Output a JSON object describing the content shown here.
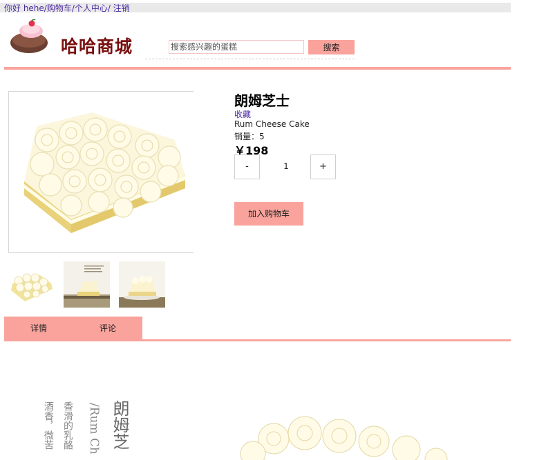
{
  "topbar": {
    "greeting": "你好 hehe",
    "cart": "购物车",
    "profile": "个人中心",
    "logout": " 注销",
    "sep": "/"
  },
  "brand": {
    "logo_text": "哈哈商城"
  },
  "search": {
    "placeholder": "搜索感兴趣的蛋糕",
    "button_label": "搜索"
  },
  "product": {
    "name": "朗姆芝士",
    "favorite_label": "收藏",
    "english_name": "Rum Cheese Cake",
    "sales": "销量：5",
    "price": "￥198",
    "quantity": "1",
    "minus_label": "-",
    "plus_label": "+",
    "add_to_cart_label": "加入购物车"
  },
  "tabs": [
    {
      "label": "详情"
    },
    {
      "label": "评论"
    }
  ],
  "detail": {
    "title_cn": "朗姆芝",
    "title_en": "/Rum Ch",
    "desc_line1": "香滑的乳酪",
    "desc_line2": "酒香，微苦"
  },
  "colors": {
    "accent": "#f9a39c",
    "link": "#4b2aa0",
    "brand": "#7a0f0f"
  }
}
